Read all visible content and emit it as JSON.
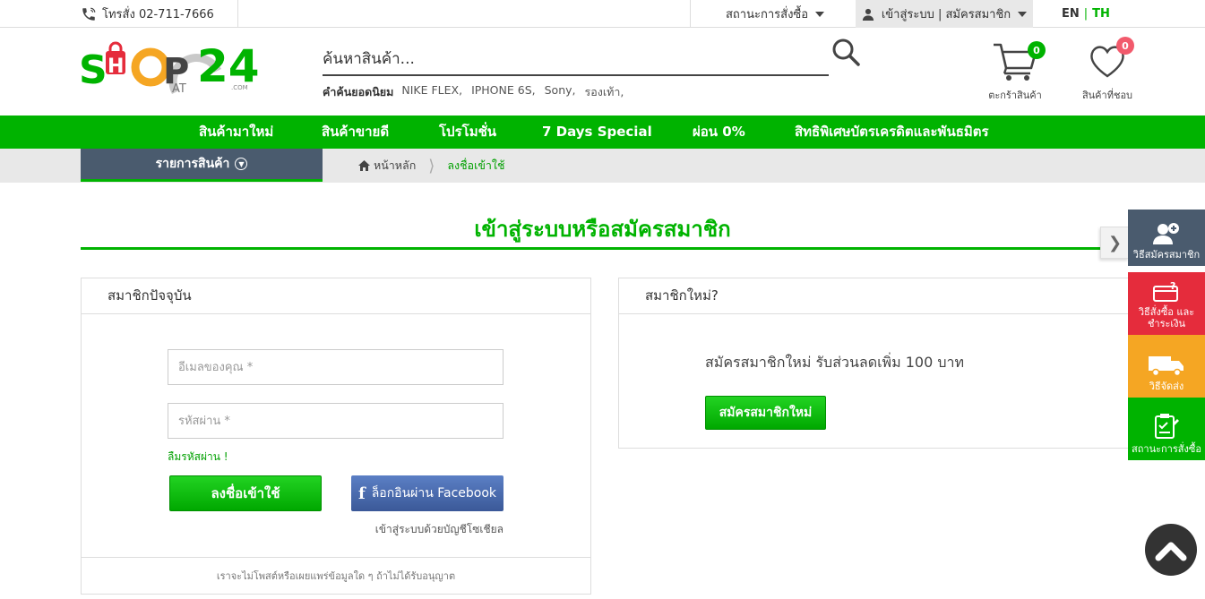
{
  "topbar": {
    "phone": "โทรสั่ง 02-711-7666",
    "order_status": "สถานะการสั่งซื้อ",
    "login_register": "เข้าสู่ระบบ | สมัครสมาชิก",
    "lang_en": "EN",
    "lang_sep": "|",
    "lang_th": "TH"
  },
  "logo": {
    "alt": "SHOP AT 24 .COM",
    "s": "S",
    "h": "H",
    "o": "O",
    "p": "P",
    "at": "AT",
    "n24": "24",
    "com": ".COM"
  },
  "search": {
    "placeholder": "ค้นหาสินค้า...",
    "popular_label": "คำค้นยอดนิยม",
    "keywords": [
      "NIKE FLEX,",
      "IPHONE 6S,",
      "Sony,",
      "รองเท้า,"
    ]
  },
  "cart": {
    "label": "ตะกร้าสินค้า",
    "count": "0"
  },
  "wishlist": {
    "label": "สินค้าที่ชอบ",
    "count": "0"
  },
  "nav": {
    "items": [
      "สินค้ามาใหม่",
      "สินค้าขายดี",
      "โปรโมชั่น",
      "7 Days Special",
      "ผ่อน 0%",
      "สิทธิพิเศษบัตรเครดิตและพันธมิตร"
    ]
  },
  "subbar": {
    "category_label": "รายการสินค้า",
    "crumb_home": "หน้าหลัก",
    "crumb_current": "ลงชื่อเข้าใช้"
  },
  "page": {
    "title": "เข้าสู่ระบบหรือสมัครสมาชิก"
  },
  "member": {
    "heading": "สมาชิกปัจจุบัน",
    "email_placeholder": "อีเมลของคุณ *",
    "password_placeholder": "รหัสผ่าน *",
    "forgot": "ลืมรหัสผ่าน !",
    "login_button": "ลงชื่อเข้าใช้",
    "facebook_button": "ล็อกอินผ่าน Facebook",
    "social_note": "เข้าสู่ระบบด้วยบัญชีโซเชียล",
    "privacy_note": "เราจะไม่โพสต์หรือเผยแพร่ข้อมูลใด ๆ ถ้าไม่ได้รับอนุญาต"
  },
  "new_member": {
    "heading": "สมาชิกใหม่?",
    "promo": "สมัครสมาชิกใหม่ รับส่วนลดเพิ่ม 100 บาท",
    "register_button": "สมัครสมาชิกใหม่"
  },
  "side_menu": {
    "how_to_register": "วิธีสมัครสมาชิก",
    "how_to_order_line1": "วิธีสั่งซื้อ และ",
    "how_to_order_line2": "ชำระเงิน",
    "shipping": "วิธีจัดส่ง",
    "order_status": "สถานะการสั่งซื้อ"
  },
  "colors": {
    "brand_green": "#00b300",
    "dark_slate": "#4a5b6e",
    "red": "#e52c3c",
    "orange": "#f5a623",
    "facebook": "#3b5998"
  },
  "icons": [
    "phone-icon",
    "user-icon",
    "search-icon",
    "cart-icon",
    "heart-icon",
    "home-icon",
    "chevron-down-icon",
    "add-user-icon",
    "card-question-icon",
    "truck-icon",
    "clipboard-icon",
    "arrow-up-icon"
  ]
}
